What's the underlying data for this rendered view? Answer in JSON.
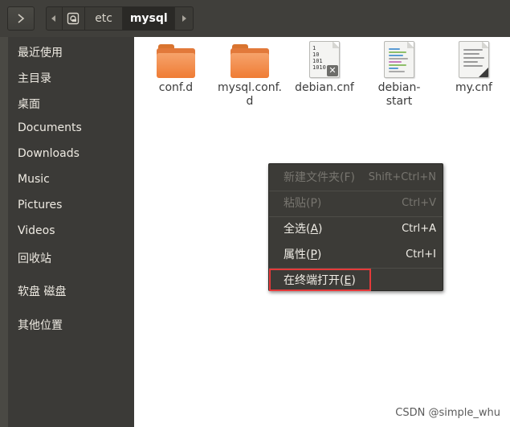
{
  "toolbar": {
    "forward_icon": "chevron-right-icon",
    "back_icon": "triangle-left-icon",
    "next_icon": "triangle-right-icon",
    "path": [
      "etc",
      "mysql"
    ]
  },
  "sidebar": {
    "items": [
      "最近使用",
      "主目录",
      "桌面",
      "Documents",
      "Downloads",
      "Music",
      "Pictures",
      "Videos",
      "回收站",
      "软盘 磁盘",
      "其他位置"
    ]
  },
  "files": [
    {
      "name": "conf.d",
      "icon": "folder-icon"
    },
    {
      "name_line1": "mysql.conf.",
      "name_line2": "d",
      "icon": "folder-icon"
    },
    {
      "name": "debian.cnf",
      "icon": "binary-file-icon",
      "binary_text": [
        "1",
        "10",
        "101",
        "1010"
      ]
    },
    {
      "name_line1": "debian-",
      "name_line2": "start",
      "icon": "script-file-icon"
    },
    {
      "name": "my.cnf",
      "icon": "text-file-icon"
    }
  ],
  "context_menu": {
    "items": [
      {
        "label": "新建文件夹(F)",
        "accel": "Shift+Ctrl+N",
        "enabled": false
      },
      {
        "label": "粘贴(P)",
        "accel": "Ctrl+V",
        "enabled": false
      },
      {
        "label_main": "全选(",
        "mnemonic": "A",
        "label_end": ")",
        "accel": "Ctrl+A",
        "enabled": true
      },
      {
        "label_main": "属性(",
        "mnemonic": "P",
        "label_end": ")",
        "accel": "Ctrl+I",
        "enabled": true
      },
      {
        "label_main": "在终端打开(",
        "mnemonic": "E",
        "label_end": ")",
        "accel": "",
        "enabled": true
      }
    ]
  },
  "watermark": "CSDN @simple_whu",
  "colors": {
    "highlight": "#e53a3a",
    "folder": "#ef7c35"
  }
}
